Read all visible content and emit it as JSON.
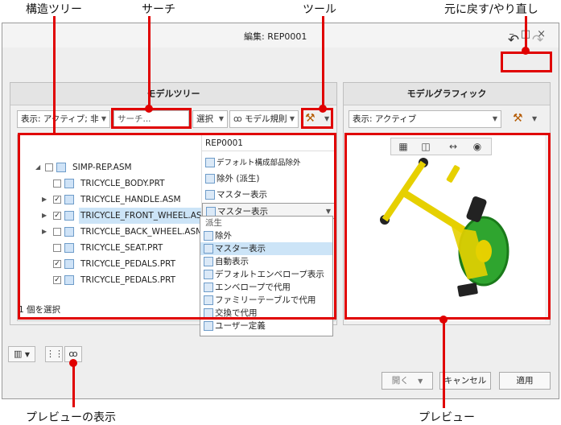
{
  "callouts": {
    "structure_tree": "構造ツリー",
    "search": "サーチ",
    "tools": "ツール",
    "undo_redo": "元に戻す/やり直し",
    "show_preview": "プレビューの表示",
    "preview": "プレビュー"
  },
  "window": {
    "title": "編集: REP0001",
    "buttons": "–□×"
  },
  "model_tree": {
    "header": "モデルツリー",
    "display_filter": "表示: アクティブ; 非",
    "search_placeholder": "サーチ...",
    "select_label": "選択",
    "rules_label": "モデル規則",
    "column_header": "REP0001",
    "rows": [
      {
        "name": "SIMP-REP.ASM",
        "rep": "デフォルト構成部品除外"
      },
      {
        "name": "TRICYCLE_BODY.PRT",
        "rep": "除外 (派生)"
      },
      {
        "name": "TRICYCLE_HANDLE.ASM",
        "rep": "マスター表示"
      },
      {
        "name": "TRICYCLE_FRONT_WHEEL.ASM",
        "rep": "マスター表示"
      },
      {
        "name": "TRICYCLE_BACK_WHEEL.ASM",
        "rep": ""
      },
      {
        "name": "TRICYCLE_SEAT.PRT",
        "rep": ""
      },
      {
        "name": "TRICYCLE_PEDALS.PRT",
        "rep": ""
      },
      {
        "name": "TRICYCLE_PEDALS.PRT",
        "rep": ""
      }
    ],
    "status": "1 個を選択",
    "dropdown_options": [
      "派生",
      "除外",
      "マスター表示",
      "自動表示",
      "デフォルトエンベロープ表示",
      "エンベロープで代用",
      "ファミリーテーブルで代用",
      "交換で代用",
      "ユーザー定義"
    ]
  },
  "model_graphic": {
    "header": "モデルグラフィック",
    "display_filter": "表示: アクティブ"
  },
  "buttons": {
    "open": "開く",
    "cancel": "キャンセル",
    "apply": "適用"
  }
}
